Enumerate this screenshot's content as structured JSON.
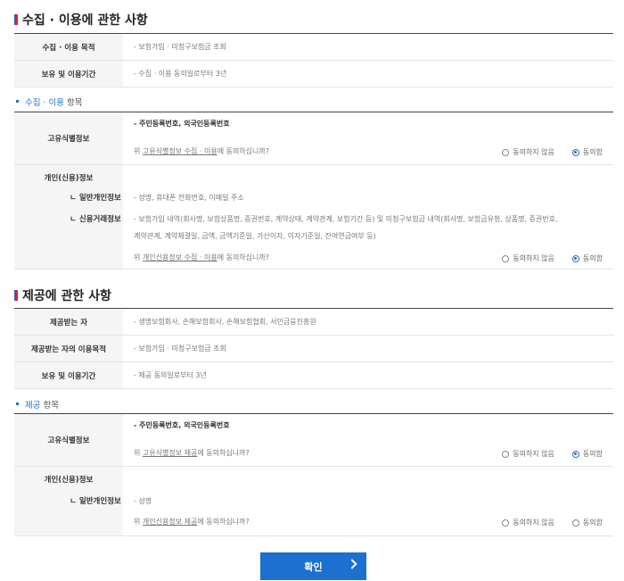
{
  "collection": {
    "title": "수집 · 이용에 관한 사항",
    "purpose_label": "수집 · 이용 목적",
    "purpose_value": "- 보험가입 · 미청구보험금 조회",
    "period_label": "보유 및 이용기간",
    "period_value": "- 수집 · 이용 동의일로부터 3년",
    "items_title_blue": "수집 · 이용",
    "items_title_rest": " 항목",
    "unique": {
      "label": "고유식별정보",
      "value": "- 주민등록번호, 외국인등록번호",
      "q_pre": "위 ",
      "q_link": "고유식별정보 수집 · 이용",
      "q_post": "에 동의하십니까?",
      "disagree": "동의하지 않음",
      "agree": "동의함",
      "selected": "agree"
    },
    "personal": {
      "label": "개인(신용)정보",
      "general_label": "ㄴ 일반개인정보",
      "general_value": "- 성명, 휴대폰 전화번호, 이메일 주소",
      "credit_label": "ㄴ 신용거래정보",
      "credit_value_1": "- 보험가입 내역(회사명, 보험상품명, 증권번호, 계약상태, 계약관계, 보험기간 등) 및 미청구보험금 내역(회사명, 보험금유형, 상품명, 증권번호,",
      "credit_value_2": "계약관계, 계약체결일, 금액, 금액기준일, 가산이자, 이자기준일, 잔여연금여부 등)",
      "q_pre": "위 ",
      "q_link": "개인신용정보 수집 · 이용",
      "q_post": "에 동의하십니까?",
      "disagree": "동의하지 않음",
      "agree": "동의함",
      "selected": "agree"
    }
  },
  "provision": {
    "title": "제공에 관한 사항",
    "recipient_label": "제공받는 자",
    "recipient_value": "- 생명보험회사, 손해보험회사, 손해보험협회, 서민금융진흥원",
    "purpose_label": "제공받는 자의 이용목적",
    "purpose_value": "- 보험가입 · 미청구보험금 조회",
    "period_label": "보유 및 이용기간",
    "period_value": "- 제공 동의일로부터 3년",
    "items_title_blue": "제공",
    "items_title_rest": " 항목",
    "unique": {
      "label": "고유식별정보",
      "value": "- 주민등록번호, 외국인등록번호",
      "q_pre": "위 ",
      "q_link": "고유식별정보 제공",
      "q_post": "에 동의하십니까?",
      "disagree": "동의하지 않음",
      "agree": "동의함",
      "selected": "agree"
    },
    "personal": {
      "label": "개인(신용)정보",
      "general_label": "ㄴ 일반개인정보",
      "general_value": "- 성명",
      "q_pre": "위 ",
      "q_link": "개인신용정보 제공",
      "q_post": "에 동의하십니까?",
      "disagree": "동의하지 않음",
      "agree": "동의함",
      "selected": "none"
    }
  },
  "confirm_label": "확인",
  "colors": {
    "accent": "#1d6fd0",
    "link_blue": "#2272c8"
  }
}
